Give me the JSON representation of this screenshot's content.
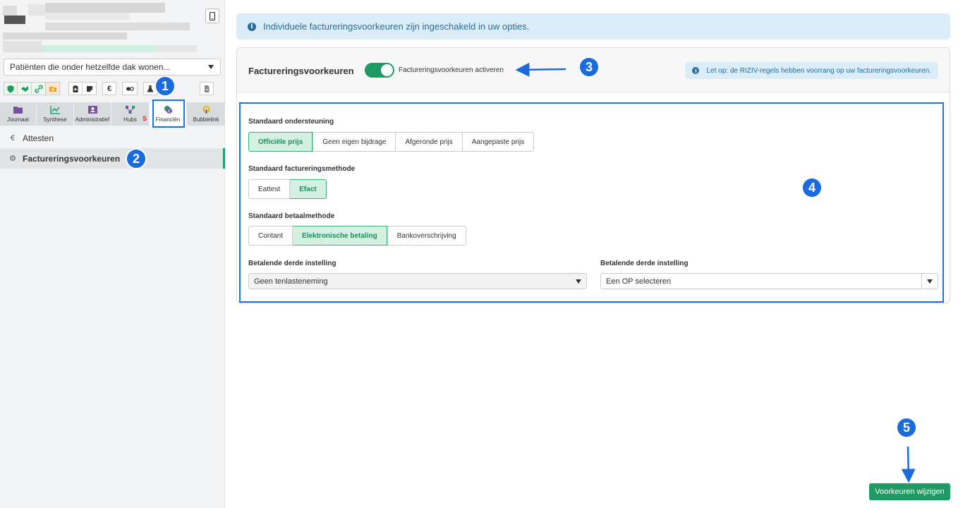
{
  "sidebar": {
    "patient_select": "Patiënten die onder hetzelfde dak wonen...",
    "tabs": [
      {
        "label": "Journaal",
        "icon": "folder-icon",
        "color": "#7b4fa0"
      },
      {
        "label": "Synthese",
        "icon": "chart-line-icon",
        "color": "#20a366"
      },
      {
        "label": "Administratief",
        "icon": "id-card-icon",
        "color": "#7b4fa0"
      },
      {
        "label": "Hubs",
        "icon": "hub-network-icon",
        "color": "#7b4fa0",
        "suffix": "S"
      },
      {
        "label": "Financiën",
        "icon": "coins-icon",
        "color": "#7b4fa0"
      },
      {
        "label": "Bubblelink",
        "icon": "bubblelink-icon",
        "color": "#e8b200"
      }
    ],
    "menu": [
      {
        "label": "Attesten",
        "icon": "euro-icon"
      },
      {
        "label": "Factureringsvoorkeuren",
        "icon": "gear-icon"
      }
    ]
  },
  "main": {
    "banner": "Individuele factureringsvoorkeuren zijn ingeschakeld in uw opties.",
    "panel": {
      "title": "Factureringsvoorkeuren",
      "toggle_label": "Factureringsvoorkeuren activeren",
      "toggle_on": true,
      "note": "Let op: de RIZIV-regels hebben voorrang op uw factureringsvoorkeuren."
    },
    "fields": {
      "support": {
        "label": "Standaard ondersteuning",
        "options": [
          "Officiële prijs",
          "Geen eigen bijdrage",
          "Afgeronde prijs",
          "Aangepaste prijs"
        ],
        "selected": "Officiële prijs"
      },
      "billing_method": {
        "label": "Standaard factureringsmethode",
        "options": [
          "Eattest",
          "Efact"
        ],
        "selected": "Efact"
      },
      "payment_method": {
        "label": "Standaard betaalmethode",
        "options": [
          "Contant",
          "Elektronische betaling",
          "Bankoverschrijving"
        ],
        "selected": "Elektronische betaling"
      },
      "third_party_1": {
        "label": "Betalende derde instelling",
        "value": "Geen tenlasteneming"
      },
      "third_party_2": {
        "label": "Betalende derde instelling",
        "value": "Een OP selecteren"
      }
    },
    "save_button": "Voorkeuren wijzigen"
  },
  "annotations": [
    "1",
    "2",
    "3",
    "4",
    "5"
  ],
  "colors": {
    "accent_green": "#1f9a62",
    "annotation_blue": "#1a6be0",
    "info_blue": "#2a6e99"
  }
}
